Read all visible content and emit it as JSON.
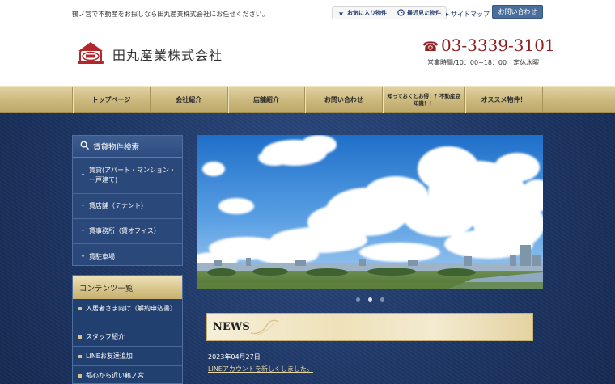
{
  "header": {
    "tagline": "鶴ノ宮で不動産をお探しなら田丸産業株式会社にお任せください。",
    "util_links": [
      {
        "label": "お気に入り物件",
        "icon": "star-icon"
      },
      {
        "label": "最近見た物件",
        "icon": "clock-icon"
      }
    ],
    "sitemap_label": "サイトマップ",
    "contact_label": "お問い合わせ",
    "company_name": "田丸産業株式会社",
    "phone": "03-3339-3101",
    "hours": "営業時間/10：00~18：00　定休水曜"
  },
  "nav": {
    "items": [
      {
        "label": "トップページ"
      },
      {
        "label": "会社紹介"
      },
      {
        "label": "店舗紹介"
      },
      {
        "label": "お問い合わせ"
      },
      {
        "label": "知っておくとお得！？不動産豆知識！！"
      },
      {
        "label": "オススメ物件！"
      }
    ]
  },
  "sidebar": {
    "search_title": "賃貸物件検索",
    "search_items": [
      {
        "label": "賃貸(アパート・マンション・一戸建て)"
      },
      {
        "label": "賃店舗（テナント）"
      },
      {
        "label": "賃事務所（賃オフィス）"
      },
      {
        "label": "賃駐車場"
      }
    ],
    "contents_title": "コンテンツ一覧",
    "contents_items": [
      {
        "label": "入居者さま向け（解約申込書）"
      },
      {
        "label": "スタッフ紹介"
      },
      {
        "label": "LINEお友達追加"
      },
      {
        "label": "都心から近い鶴ノ宮"
      }
    ]
  },
  "news": {
    "title": "NEWS",
    "items": [
      {
        "date": "2023年04月27日",
        "text": "LINEアカウントを新しくしました。"
      }
    ]
  },
  "slider": {
    "count": 3,
    "active": 1
  },
  "colors": {
    "navy": "#1e3766",
    "gold": "#cbb87e",
    "phone_red": "#8e1f20",
    "link_gold": "#e9d9a4"
  }
}
